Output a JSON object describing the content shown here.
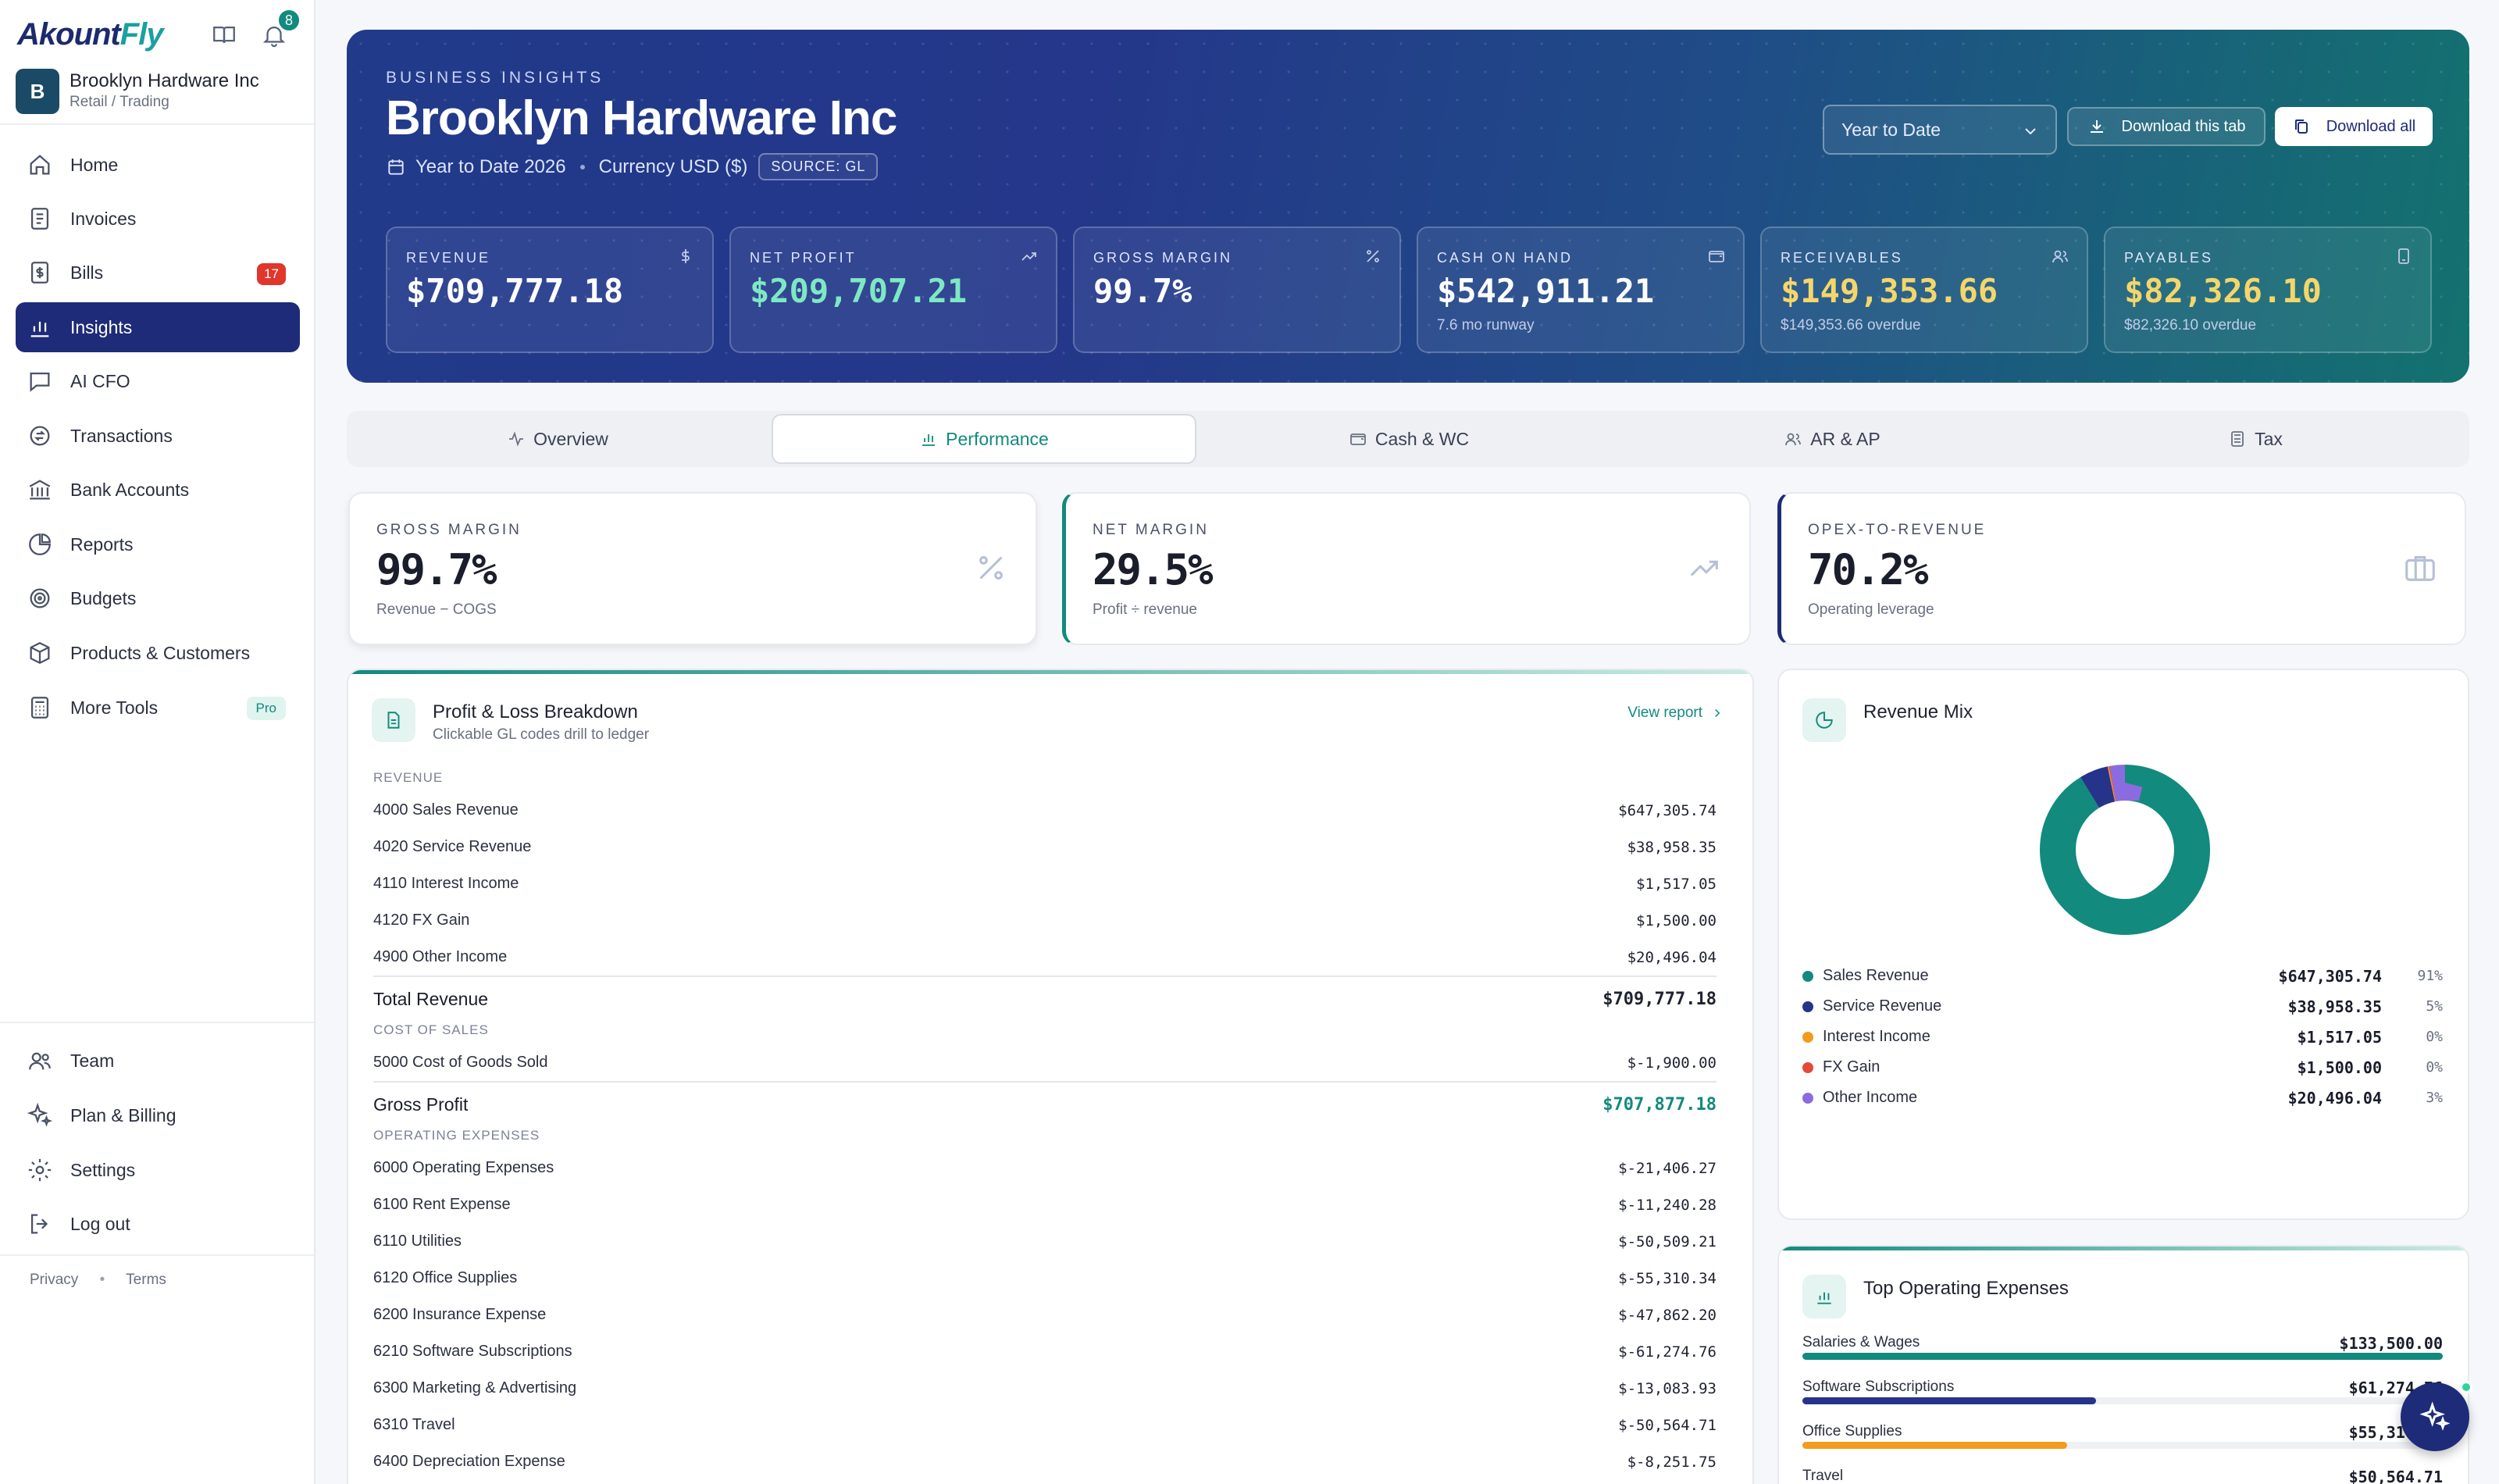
{
  "app": {
    "logo_prefix": "Akount",
    "logo_suffix": "Fly",
    "notifications": "8"
  },
  "company": {
    "initial": "B",
    "name": "Brooklyn Hardware Inc",
    "type": "Retail / Trading"
  },
  "nav": {
    "home": "Home",
    "invoices": "Invoices",
    "bills": "Bills",
    "bills_count": "17",
    "insights": "Insights",
    "ai_cfo": "AI CFO",
    "transactions": "Transactions",
    "bank_accounts": "Bank Accounts",
    "reports": "Reports",
    "budgets": "Budgets",
    "products": "Products & Customers",
    "more_tools": "More Tools",
    "pro_badge": "Pro",
    "team": "Team",
    "plan": "Plan & Billing",
    "settings": "Settings",
    "logout": "Log out",
    "privacy": "Privacy",
    "terms": "Terms"
  },
  "hero": {
    "eyebrow": "BUSINESS INSIGHTS",
    "title": "Brooklyn Hardware Inc",
    "period": "Year to Date 2026",
    "currency": "Currency USD ($)",
    "source": "SOURCE: GL",
    "period_select": "Year to Date",
    "download_tab": "Download this tab",
    "download_all": "Download all"
  },
  "kpis": [
    {
      "label": "REVENUE",
      "value": "$709,777.18",
      "sub": "",
      "icon": "dollar-icon"
    },
    {
      "label": "NET PROFIT",
      "value": "$209,707.21",
      "sub": "",
      "icon": "trend-up-icon"
    },
    {
      "label": "GROSS MARGIN",
      "value": "99.7%",
      "sub": "",
      "icon": "percent-icon"
    },
    {
      "label": "CASH ON HAND",
      "value": "$542,911.21",
      "sub": "7.6 mo runway",
      "icon": "wallet-icon"
    },
    {
      "label": "RECEIVABLES",
      "value": "$149,353.66",
      "sub": "$149,353.66 overdue",
      "icon": "users-icon"
    },
    {
      "label": "PAYABLES",
      "value": "$82,326.10",
      "sub": "$82,326.10 overdue",
      "icon": "phone-icon"
    }
  ],
  "tabs": {
    "overview": "Overview",
    "performance": "Performance",
    "cash": "Cash & WC",
    "arap": "AR & AP",
    "tax": "Tax"
  },
  "metrics": [
    {
      "label": "GROSS MARGIN",
      "value": "99.7%",
      "sub": "Revenue − COGS"
    },
    {
      "label": "NET MARGIN",
      "value": "29.5%",
      "sub": "Profit ÷ revenue"
    },
    {
      "label": "OPEX-TO-REVENUE",
      "value": "70.2%",
      "sub": "Operating leverage"
    }
  ],
  "pl": {
    "title": "Profit & Loss Breakdown",
    "subtitle": "Clickable GL codes drill to ledger",
    "view_report": "View report",
    "revenue_header": "REVENUE",
    "revenue": [
      {
        "name": "4000 Sales Revenue",
        "amount": "$647,305.74"
      },
      {
        "name": "4020 Service Revenue",
        "amount": "$38,958.35"
      },
      {
        "name": "4110 Interest Income",
        "amount": "$1,517.05"
      },
      {
        "name": "4120 FX Gain",
        "amount": "$1,500.00"
      },
      {
        "name": "4900 Other Income",
        "amount": "$20,496.04"
      }
    ],
    "total_revenue_label": "Total Revenue",
    "total_revenue": "$709,777.18",
    "cos_header": "COST OF SALES",
    "cos": [
      {
        "name": "5000 Cost of Goods Sold",
        "amount": "$-1,900.00"
      }
    ],
    "gross_profit_label": "Gross Profit",
    "gross_profit": "$707,877.18",
    "opex_header": "OPERATING EXPENSES",
    "opex": [
      {
        "name": "6000 Operating Expenses",
        "amount": "$-21,406.27"
      },
      {
        "name": "6100 Rent Expense",
        "amount": "$-11,240.28"
      },
      {
        "name": "6110 Utilities",
        "amount": "$-50,509.21"
      },
      {
        "name": "6120 Office Supplies",
        "amount": "$-55,310.34"
      },
      {
        "name": "6200 Insurance Expense",
        "amount": "$-47,862.20"
      },
      {
        "name": "6210 Software Subscriptions",
        "amount": "$-61,274.76"
      },
      {
        "name": "6300 Marketing & Advertising",
        "amount": "$-13,083.93"
      },
      {
        "name": "6310 Travel",
        "amount": "$-50,564.71"
      },
      {
        "name": "6400 Depreciation Expense",
        "amount": "$-8,251.75"
      }
    ]
  },
  "revenue_mix": {
    "title": "Revenue Mix",
    "items": [
      {
        "name": "Sales Revenue",
        "amount": "$647,305.74",
        "pct": "91%",
        "value": 647305.74,
        "color": "#128a7d"
      },
      {
        "name": "Service Revenue",
        "amount": "$38,958.35",
        "pct": "5%",
        "value": 38958.35,
        "color": "#26338a"
      },
      {
        "name": "Interest Income",
        "amount": "$1,517.05",
        "pct": "0%",
        "value": 1517.05,
        "color": "#f29b1d"
      },
      {
        "name": "FX Gain",
        "amount": "$1,500.00",
        "pct": "0%",
        "value": 1500.0,
        "color": "#e44a3a"
      },
      {
        "name": "Other Income",
        "amount": "$20,496.04",
        "pct": "3%",
        "value": 20496.04,
        "color": "#8a6ce0"
      }
    ]
  },
  "top_opex": {
    "title": "Top Operating Expenses",
    "items": [
      {
        "name": "Salaries & Wages",
        "amount": "$133,500.00",
        "fraction": 1.0,
        "color": "#128a7d"
      },
      {
        "name": "Software Subscriptions",
        "amount": "$61,274.76",
        "fraction": 0.459,
        "color": "#26338a"
      },
      {
        "name": "Office Supplies",
        "amount": "$55,310.34",
        "fraction": 0.414,
        "color": "#f29b1d"
      },
      {
        "name": "Travel",
        "amount": "$50,564.71",
        "fraction": 0.379,
        "color": "#8a6ce0"
      }
    ]
  }
}
